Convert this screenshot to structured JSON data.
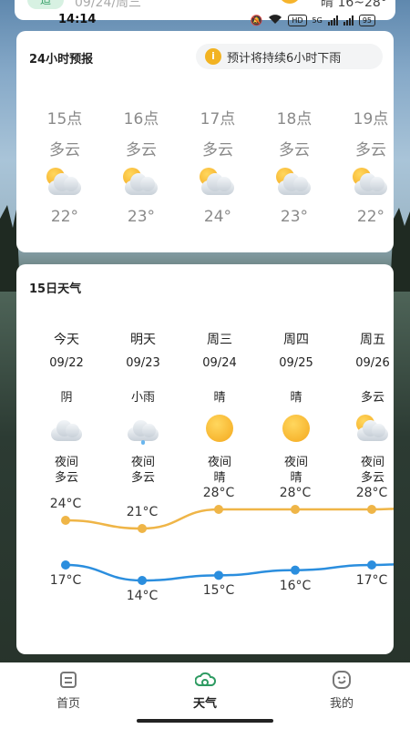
{
  "status_bar": {
    "time": "14:14",
    "hd_label": "HD",
    "net_label": "5G",
    "battery": "95"
  },
  "top_card": {
    "badge": "适",
    "date": "09/24/周三",
    "range": "晴 16~28°"
  },
  "hourly": {
    "title": "24小时预报",
    "notice_icon": "i",
    "notice": "预计将持续6小时下雨",
    "items": [
      {
        "time": "15点",
        "condition": "多云",
        "icon": "partly-cloudy-icon",
        "temp": "22°"
      },
      {
        "time": "16点",
        "condition": "多云",
        "icon": "partly-cloudy-icon",
        "temp": "23°"
      },
      {
        "time": "17点",
        "condition": "多云",
        "icon": "partly-cloudy-icon",
        "temp": "24°"
      },
      {
        "time": "18点",
        "condition": "多云",
        "icon": "partly-cloudy-icon",
        "temp": "23°"
      },
      {
        "time": "19点",
        "condition": "多云",
        "icon": "partly-cloudy-icon",
        "temp": "22°"
      }
    ]
  },
  "daily": {
    "title": "15日天气",
    "items": [
      {
        "name": "今天",
        "date": "09/22",
        "condition": "阴",
        "icon": "cloudy-icon",
        "night_label": "夜间",
        "night_condition": "多云",
        "high": 24,
        "low": 17,
        "high_label": "24°C",
        "low_label": "17°C"
      },
      {
        "name": "明天",
        "date": "09/23",
        "condition": "小雨",
        "icon": "light-rain-icon",
        "night_label": "夜间",
        "night_condition": "多云",
        "high": 21,
        "low": 14,
        "high_label": "21°C",
        "low_label": "14°C"
      },
      {
        "name": "周三",
        "date": "09/24",
        "condition": "晴",
        "icon": "sunny-icon",
        "night_label": "夜间",
        "night_condition": "晴",
        "high": 28,
        "low": 15,
        "high_label": "28°C",
        "low_label": "15°C"
      },
      {
        "name": "周四",
        "date": "09/25",
        "condition": "晴",
        "icon": "sunny-icon",
        "night_label": "夜间",
        "night_condition": "晴",
        "high": 28,
        "low": 16,
        "high_label": "28°C",
        "low_label": "16°C"
      },
      {
        "name": "周五",
        "date": "09/26",
        "condition": "多云",
        "icon": "partly-cloudy-icon",
        "night_label": "夜间",
        "night_condition": "多云",
        "high": 28,
        "low": 17,
        "high_label": "28°C",
        "low_label": "17°C"
      }
    ],
    "colors": {
      "high_line": "#efb547",
      "low_line": "#2b8ede"
    }
  },
  "tabbar": {
    "items": [
      {
        "label": "首页",
        "icon": "calendar-icon",
        "active": false
      },
      {
        "label": "天气",
        "icon": "weather-icon",
        "active": true
      },
      {
        "label": "我的",
        "icon": "smile-icon",
        "active": false
      }
    ],
    "accent": "#2e9b62"
  }
}
